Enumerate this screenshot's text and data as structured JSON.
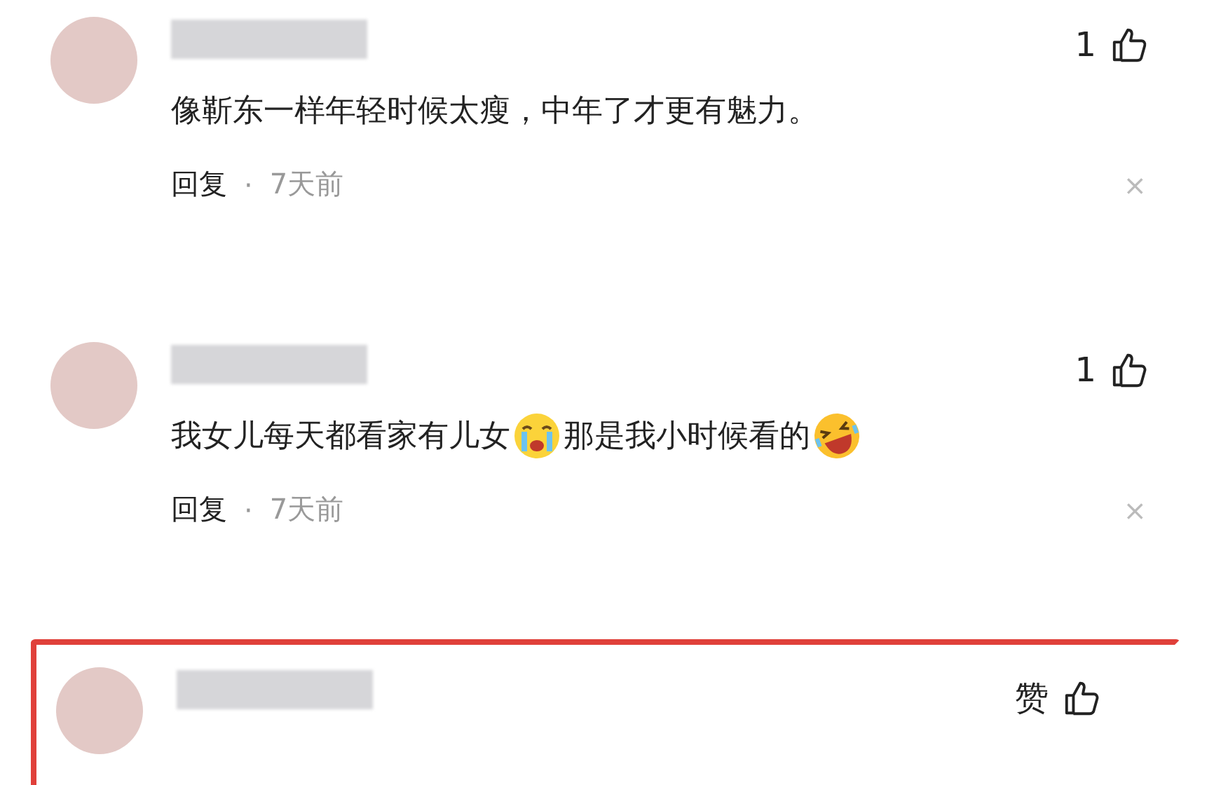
{
  "comments": [
    {
      "highlighted": false,
      "like_label": "1",
      "content": [
        {
          "kind": "text",
          "text": "像靳东一样年轻时候太瘦，中年了才更有魅力。"
        }
      ],
      "reply": "回复",
      "dot": "·",
      "time": "7天前",
      "close": "×"
    },
    {
      "highlighted": false,
      "like_label": "1",
      "content": [
        {
          "kind": "text",
          "text": "我女儿每天都看家有儿女"
        },
        {
          "kind": "cry"
        },
        {
          "kind": "text",
          "text": "那是我小时候看的"
        },
        {
          "kind": "laugh"
        }
      ],
      "reply": "回复",
      "dot": "·",
      "time": "7天前",
      "close": "×"
    },
    {
      "highlighted": true,
      "like_label": "赞"
    }
  ]
}
